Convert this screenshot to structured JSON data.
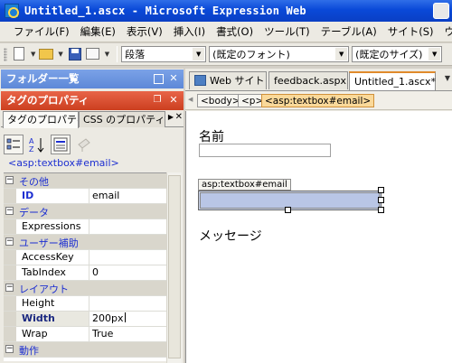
{
  "titlebar": {
    "title": "Untitled_1.ascx - Microsoft Expression Web"
  },
  "menu": [
    "ファイル(F)",
    "編集(E)",
    "表示(V)",
    "挿入(I)",
    "書式(O)",
    "ツール(T)",
    "テーブル(A)",
    "サイト(S)",
    "ウ"
  ],
  "toolbar": {
    "style_value": "段落",
    "font_value": "(既定のフォント)",
    "size_value": "(既定のサイズ)"
  },
  "folder_panel": {
    "title": "フォルダー一覧"
  },
  "tag_props_panel": {
    "title": "タグのプロパティ",
    "tabs": [
      "タグのプロパティ",
      "CSS のプロパティ"
    ],
    "tag_name": "<asp:textbox#email>",
    "rows": [
      {
        "type": "category",
        "label": "その他"
      },
      {
        "type": "prop",
        "name": "ID",
        "value": "email",
        "style": "bold"
      },
      {
        "type": "category",
        "label": "データ"
      },
      {
        "type": "prop",
        "name": "Expressions",
        "value": ""
      },
      {
        "type": "category",
        "label": "ユーザー補助"
      },
      {
        "type": "prop",
        "name": "AccessKey",
        "value": ""
      },
      {
        "type": "prop",
        "name": "TabIndex",
        "value": "0"
      },
      {
        "type": "category",
        "label": "レイアウト"
      },
      {
        "type": "prop",
        "name": "Height",
        "value": ""
      },
      {
        "type": "prop",
        "name": "Width",
        "value": "200px",
        "style": "editing"
      },
      {
        "type": "prop",
        "name": "Wrap",
        "value": "True"
      },
      {
        "type": "category",
        "label": "動作"
      }
    ]
  },
  "editor": {
    "tabs": [
      "Web サイト",
      "feedback.aspx",
      "Untitled_1.ascx*"
    ],
    "breadcrumbs": [
      "<body>",
      "<p>",
      "<asp:textbox#email>"
    ],
    "design": {
      "label_name": "名前",
      "selected_tag": "asp:textbox#email",
      "label_message": "メッセージ"
    }
  }
}
